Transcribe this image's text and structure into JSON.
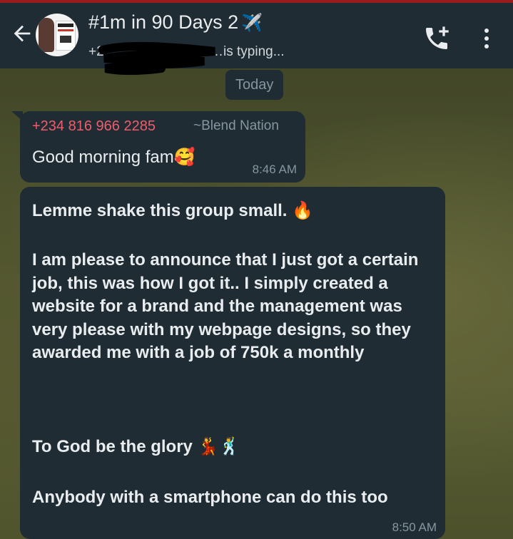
{
  "header": {
    "title": "#1m in 90 Days 2",
    "title_emoji": "✈️",
    "subtitle_start": "+2",
    "subtitle_end": "…is typing...",
    "icons": [
      "back-arrow-icon",
      "group-avatar",
      "add-call-icon",
      "more-vert-icon"
    ]
  },
  "chat": {
    "date_chip": "Today",
    "messages": [
      {
        "sender": "+234 816 966 2285",
        "push_name": "~Blend Nation",
        "text": "Good morning fam",
        "emoji": "🥰",
        "time": "8:46 AM"
      },
      {
        "paragraphs": [
          "Lemme shake this group small.",
          "I am please to announce that I just got a certain job, this was how I got it.. I simply created a website for a brand and the management was very please with my webpage designs, so they awarded me with a job of 750k a monthly",
          "To God be the glory",
          "Anybody with a smartphone can do this too"
        ],
        "emoji_fire": "🔥",
        "emoji_glory": "💃🕺",
        "time": "8:50 AM"
      }
    ]
  },
  "colors": {
    "header_bg": "#202c33",
    "bubble_bg": "#1f2c33",
    "sender_color": "#f15c6d",
    "meta_color": "#8696a0",
    "text_color": "#e9edef"
  }
}
